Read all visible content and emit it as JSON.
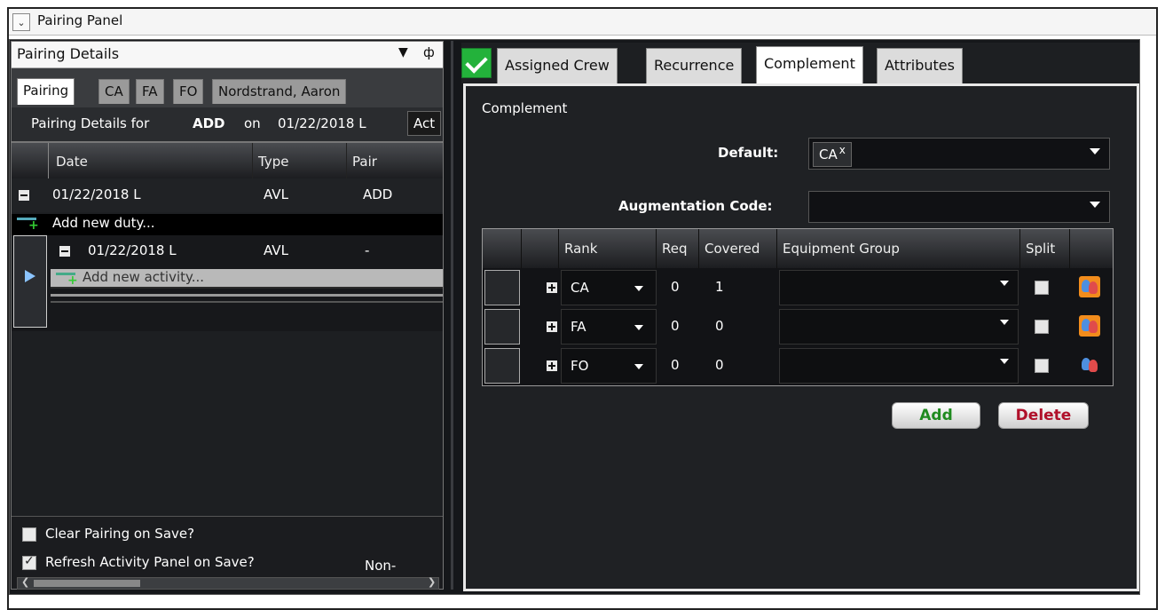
{
  "window": {
    "title": "Pairing Panel"
  },
  "left": {
    "header_title": "Pairing Details",
    "tabs": [
      {
        "label": "Pairing",
        "active": true
      },
      {
        "label": "CA",
        "active": false
      },
      {
        "label": "FA",
        "active": false
      },
      {
        "label": "FO",
        "active": false
      },
      {
        "label": "Nordstrand, Aaron",
        "active": false
      }
    ],
    "details": {
      "prefix": "Pairing Details for",
      "code": "ADD",
      "on": "on",
      "date": "01/22/2018 L",
      "act": "Act"
    },
    "columns": [
      "Date",
      "Type",
      "Pair"
    ],
    "duty_row": {
      "date": "01/22/2018 L",
      "type": "AVL",
      "pair": "ADD"
    },
    "add_duty": "Add new duty...",
    "activity_row": {
      "date": "01/22/2018 L",
      "type": "AVL",
      "pair": "-"
    },
    "add_activity": "Add new activity...",
    "footer": {
      "clear_label": "Clear Pairing on Save?",
      "clear_checked": false,
      "refresh_label": "Refresh Activity Panel on Save?",
      "refresh_checked": true,
      "nonconn": "Non-connec"
    }
  },
  "right": {
    "tabs": [
      {
        "label": "Assigned Crew",
        "active": false
      },
      {
        "label": "Recurrence",
        "active": false
      },
      {
        "label": "Complement",
        "active": true
      },
      {
        "label": "Attributes",
        "active": false
      }
    ],
    "section_title": "Complement",
    "default_label": "Default:",
    "default_chip": "CA",
    "chip_remove": "x",
    "augmentation_label": "Augmentation Code:",
    "columns": [
      "Rank",
      "Req",
      "Covered",
      "Equipment Group",
      "Split"
    ],
    "rows": [
      {
        "rank": "CA",
        "req": "0",
        "covered": "1",
        "equipment": "",
        "split": false,
        "icon_highlight": true
      },
      {
        "rank": "FA",
        "req": "0",
        "covered": "0",
        "equipment": "",
        "split": false,
        "icon_highlight": true
      },
      {
        "rank": "FO",
        "req": "0",
        "covered": "0",
        "equipment": "",
        "split": false,
        "icon_highlight": false
      }
    ],
    "add_button": "Add",
    "delete_button": "Delete"
  },
  "colors": {
    "accent_green": "#23b23b",
    "add_text": "#1f8a1f",
    "delete_text": "#b0102a",
    "icon_highlight": "#f28c1c"
  }
}
